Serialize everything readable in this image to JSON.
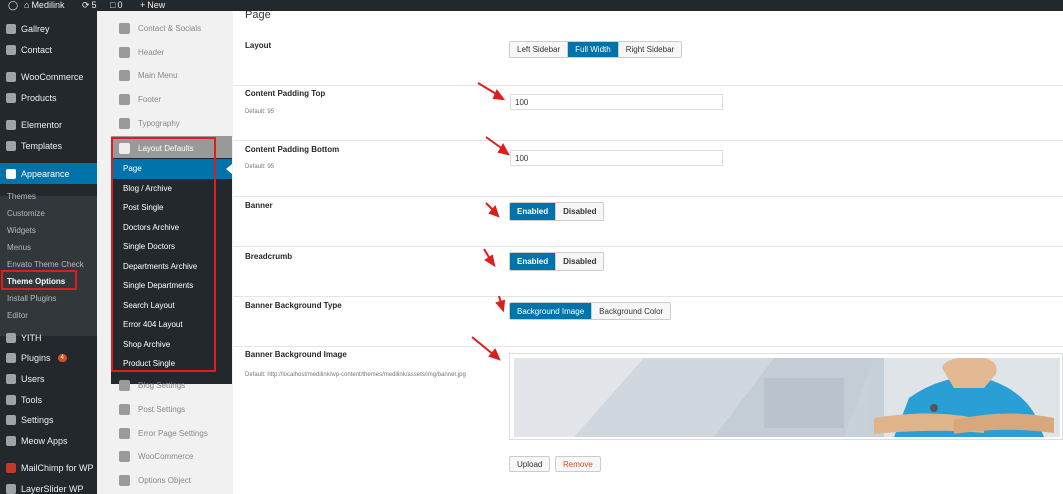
{
  "admin_bar": {
    "site_name": "Medilink",
    "updates_count": "5",
    "comments_count": "0",
    "new_label": "New"
  },
  "admin_menu": {
    "items_top": [
      {
        "label": "Gallrey",
        "icon": "gallery-icon"
      },
      {
        "label": "Contact",
        "icon": "mail-icon"
      },
      {
        "label": "WooCommerce",
        "icon": "woocommerce-icon"
      },
      {
        "label": "Products",
        "icon": "box-icon"
      },
      {
        "label": "Elementor",
        "icon": "elementor-icon"
      },
      {
        "label": "Templates",
        "icon": "folder-icon"
      },
      {
        "label": "Appearance",
        "icon": "brush-icon"
      }
    ],
    "appearance_sub": [
      "Themes",
      "Customize",
      "Widgets",
      "Menus",
      "Envato Theme Check",
      "Theme Options",
      "Install Plugins",
      "Editor"
    ],
    "items_bottom": [
      {
        "label": "YITH",
        "icon": "yith-icon"
      },
      {
        "label": "Plugins",
        "icon": "plug-icon",
        "badge": "4"
      },
      {
        "label": "Users",
        "icon": "user-icon"
      },
      {
        "label": "Tools",
        "icon": "wrench-icon"
      },
      {
        "label": "Settings",
        "icon": "settings-icon"
      },
      {
        "label": "Meow Apps",
        "icon": "meow-icon"
      },
      {
        "label": "MailChimp for WP",
        "icon": "mailchimp-icon"
      },
      {
        "label": "LayerSlider WP",
        "icon": "layers-icon"
      }
    ]
  },
  "options_panel": {
    "top_sections": [
      "Contact & Socials",
      "Header",
      "Main Menu",
      "Footer",
      "Typography"
    ],
    "active_section": "Layout Defaults",
    "layout_sub": [
      "Page",
      "Blog / Archive",
      "Post Single",
      "Doctors Archive",
      "Single Doctors",
      "Departments Archive",
      "Single Departments",
      "Search Layout",
      "Error 404 Layout",
      "Shop Archive",
      "Product Single"
    ],
    "bottom_sections": [
      "Blog Settings",
      "Post Settings",
      "Error Page Settings",
      "WooCommerce",
      "Options Object"
    ]
  },
  "page_settings": {
    "section_title": "Page",
    "layout": {
      "label": "Layout",
      "options": [
        "Left Sidebar",
        "Full Width",
        "Right Sidebar"
      ],
      "selected": "Full Width"
    },
    "padding_top": {
      "label": "Content Padding Top",
      "default_text": "Default: 95",
      "value": "100"
    },
    "padding_bottom": {
      "label": "Content Padding Bottom",
      "default_text": "Default: 95",
      "value": "100"
    },
    "banner": {
      "label": "Banner",
      "enabled": "Enabled",
      "disabled": "Disabled",
      "selected": "Enabled"
    },
    "breadcrumb": {
      "label": "Breadcrumb",
      "enabled": "Enabled",
      "disabled": "Disabled",
      "selected": "Enabled"
    },
    "banner_bg_type": {
      "label": "Banner Background Type",
      "options": [
        "Background Image",
        "Background Color"
      ],
      "selected": "Background Image"
    },
    "banner_bg_image": {
      "label": "Banner Background Image",
      "default_text": "Default: http://localhost/medilink/wp-content/themes/medilink/assets/img/banner.jpg",
      "upload": "Upload",
      "remove": "Remove"
    }
  },
  "colors": {
    "accent": "#0073aa",
    "sidebar": "#23282d",
    "highlight": "#dc1e1e",
    "remove_text": "#d54e21"
  }
}
